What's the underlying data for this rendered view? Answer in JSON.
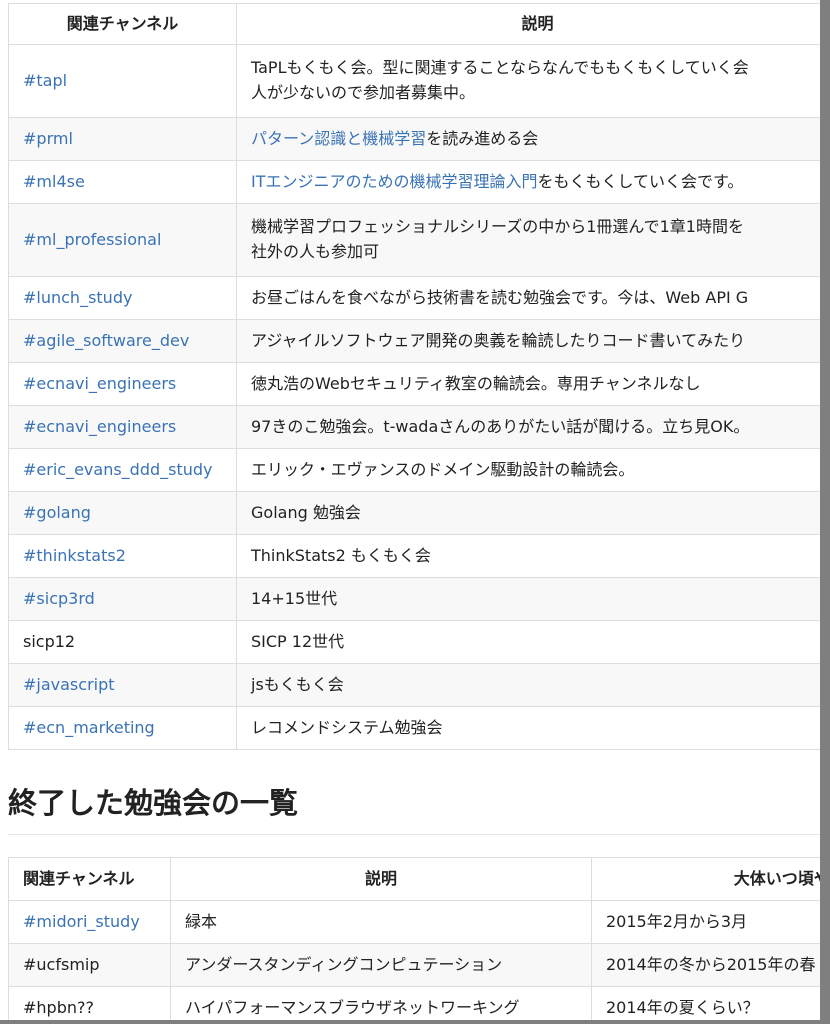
{
  "table1": {
    "headers": [
      "関連チャンネル",
      "説明"
    ],
    "rows": [
      {
        "channel": "#tapl",
        "link": true,
        "desc_line1": "TaPLもくもく会。型に関連することならなんでももくもくしていく会",
        "desc_line2": "人が少ないので参加者募集中。"
      },
      {
        "channel": "#prml",
        "link": true,
        "desc_link": "パターン認識と機械学習",
        "desc_rest": "を読み進める会"
      },
      {
        "channel": "#ml4se",
        "link": true,
        "desc_link": "ITエンジニアのための機械学習理論入門",
        "desc_rest": "をもくもくしていく会です。"
      },
      {
        "channel": "#ml_professional",
        "link": true,
        "desc_line1": "機械学習プロフェッショナルシリーズの中から1冊選んで1章1時間を",
        "desc_line2": "社外の人も参加可"
      },
      {
        "channel": "#lunch_study",
        "link": true,
        "desc": "お昼ごはんを食べながら技術書を読む勉強会です。今は、Web API G"
      },
      {
        "channel": "#agile_software_dev",
        "link": true,
        "desc": "アジャイルソフトウェア開発の奥義を輪読したりコード書いてみたり"
      },
      {
        "channel": "#ecnavi_engineers",
        "link": true,
        "desc": "徳丸浩のWebセキュリティ教室の輪読会。専用チャンネルなし"
      },
      {
        "channel": "#ecnavi_engineers",
        "link": true,
        "desc": "97きのこ勉強会。t-wadaさんのありがたい話が聞ける。立ち見OK。"
      },
      {
        "channel": "#eric_evans_ddd_study",
        "link": true,
        "desc": "エリック・エヴァンスのドメイン駆動設計の輪読会。"
      },
      {
        "channel": "#golang",
        "link": true,
        "desc": "Golang 勉強会"
      },
      {
        "channel": "#thinkstats2",
        "link": true,
        "desc": "ThinkStats2 もくもく会"
      },
      {
        "channel": "#sicp3rd",
        "link": true,
        "desc": "14+15世代"
      },
      {
        "channel": "sicp12",
        "link": false,
        "desc": "SICP 12世代"
      },
      {
        "channel": "#javascript",
        "link": true,
        "desc": "jsもくもく会"
      },
      {
        "channel": "#ecn_marketing",
        "link": true,
        "desc": "レコメンドシステム勉強会"
      }
    ]
  },
  "section_title": "終了した勉強会の一覧",
  "table2": {
    "headers": [
      "関連チャンネル",
      "説明",
      "大体いつ頃やって"
    ],
    "rows": [
      {
        "channel": "#midori_study",
        "link": true,
        "desc": "緑本",
        "when": "2015年2月から3月"
      },
      {
        "channel": "#ucfsmip",
        "link": false,
        "desc": "アンダースタンディングコンピュテーション",
        "when": "2014年の冬から2015年の春"
      },
      {
        "channel": "#hpbn??",
        "link": false,
        "desc": "ハイパフォーマンスブラウザネットワーキング",
        "when": "2014年の夏くらい？"
      }
    ]
  }
}
